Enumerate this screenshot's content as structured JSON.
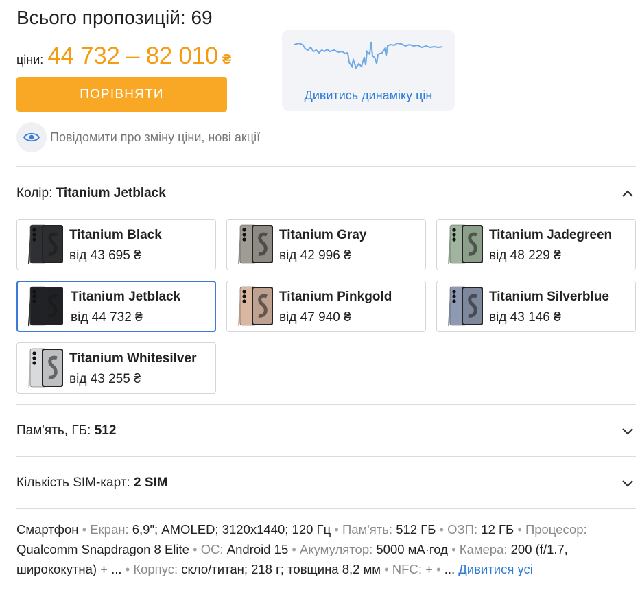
{
  "header": {
    "title": "Всього пропозицій: 69",
    "price_label": "ціни:",
    "price_range": "44 732 – 82 010",
    "currency": "₴"
  },
  "compare_button": {
    "label": "ПОРІВНЯТИ"
  },
  "price_dynamics": {
    "link_label": "Дивитись динаміку цін"
  },
  "notify": {
    "label": "Повідомити про зміну ціни, нові акції"
  },
  "color_section": {
    "label": "Колір:",
    "value": "Titanium Jetblack"
  },
  "colors": [
    {
      "name": "Titanium Black",
      "price": "від 43 695 ₴",
      "swatch": "#2e3033"
    },
    {
      "name": "Titanium Gray",
      "price": "від 42 996 ₴",
      "swatch": "#a09c95"
    },
    {
      "name": "Titanium Jadegreen",
      "price": "від 48 229 ₴",
      "swatch": "#9fb59d"
    },
    {
      "name": "Titanium Jetblack",
      "price": "від 44 732 ₴",
      "swatch": "#1f2124",
      "selected": true
    },
    {
      "name": "Titanium Pinkgold",
      "price": "від 47 940 ₴",
      "swatch": "#d9b7a1"
    },
    {
      "name": "Titanium Silverblue",
      "price": "від 43 146 ₴",
      "swatch": "#8e9ab2"
    },
    {
      "name": "Titanium Whitesilver",
      "price": "від 43 255 ₴",
      "swatch": "#d9dadc"
    }
  ],
  "memory_section": {
    "label": "Пам'ять, ГБ:",
    "value": "512"
  },
  "sim_section": {
    "label": "Кількість SIM-карт:",
    "value": "2 SIM"
  },
  "specs": {
    "type": "Смартфон",
    "screen_key": "Екран:",
    "screen_val": "6,9\"; AMOLED; 3120x1440; 120 Гц",
    "memory_key": "Пам'ять:",
    "memory_val": "512 ГБ",
    "ram_key": "ОЗП:",
    "ram_val": "12 ГБ",
    "cpu_key": "Процесор:",
    "cpu_val": "Qualcomm Snapdragon 8 Elite",
    "os_key": "ОС:",
    "os_val": "Android 15",
    "battery_key": "Акумулятор:",
    "battery_val": "5000 мА·год",
    "camera_key": "Камера:",
    "camera_val": "200 (f/1.7, ширококутна) + ...",
    "body_key": "Корпус:",
    "body_val": "скло/титан; 218 г; товщина 8,2 мм",
    "nfc_key": "NFC:",
    "nfc_val": "+",
    "ellipsis": "...",
    "see_all": "Дивитися усі"
  },
  "colors_theme": {
    "accent_orange": "#f9a825",
    "price_orange": "#f39c12",
    "link_blue": "#2b7bd6",
    "selected_border": "#3b7ad9"
  }
}
